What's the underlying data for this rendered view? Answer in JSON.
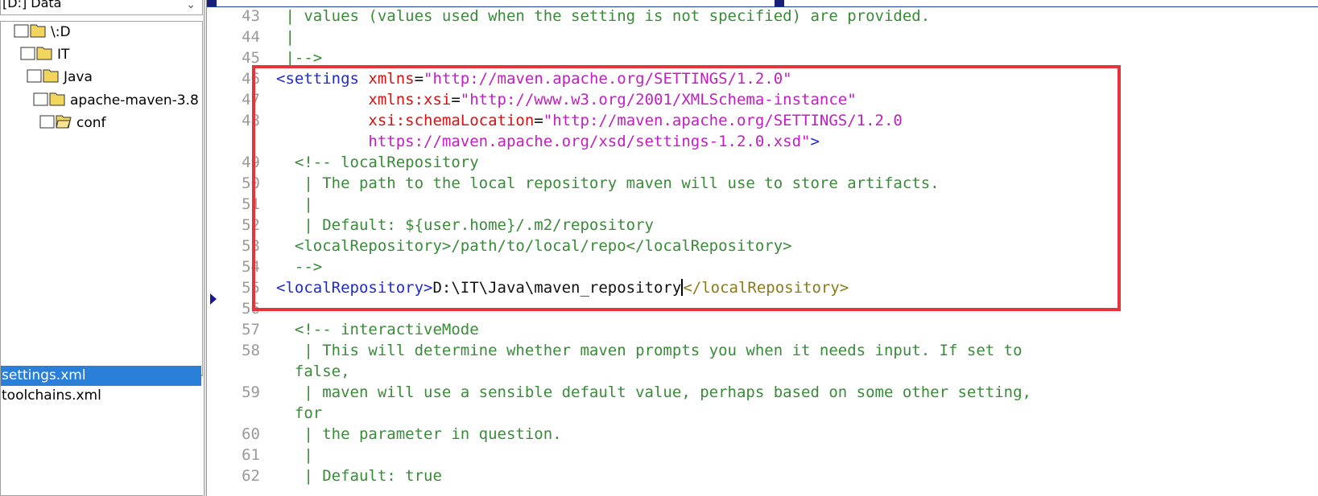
{
  "drive_selector": {
    "value": "[D:] Data"
  },
  "folder_tree": [
    {
      "label": "\\:D"
    },
    {
      "label": "IT"
    },
    {
      "label": "Java"
    },
    {
      "label": "apache-maven-3.8"
    },
    {
      "label": "conf"
    }
  ],
  "file_list": [
    {
      "label": "settings.xml",
      "selected": true
    },
    {
      "label": "toolchains.xml",
      "selected": false
    }
  ],
  "editor": {
    "lines": {
      "l43": {
        "num": "43",
        "text": " | values (values used when the setting is not specified) are provided."
      },
      "l44": {
        "num": "44",
        "text": " |"
      },
      "l45": {
        "num": "45",
        "text": " |-->"
      },
      "l46": {
        "num": "46",
        "open": "<settings ",
        "attr1": "xmlns",
        "eq1": "=",
        "val1": "\"http://maven.apache.org/SETTINGS/1.2.0\""
      },
      "l47": {
        "num": "47",
        "indent": "          ",
        "attr": "xmlns:xsi",
        "eq": "=",
        "val": "\"http://www.w3.org/2001/XMLSchema-instance\""
      },
      "l48": {
        "num": "48",
        "indent": "          ",
        "attr": "xsi:schemaLocation",
        "eq": "=",
        "val": "\"http://maven.apache.org/SETTINGS/1.2.0"
      },
      "l48b": {
        "indent": "          ",
        "val": "https://maven.apache.org/xsd/settings-1.2.0.xsd\"",
        "close": ">"
      },
      "l49": {
        "num": "49",
        "text": "  <!-- localRepository"
      },
      "l50": {
        "num": "50",
        "text": "   | The path to the local repository maven will use to store artifacts."
      },
      "l51": {
        "num": "51",
        "text": "   |"
      },
      "l52": {
        "num": "52",
        "text": "   | Default: ${user.home}/.m2/repository"
      },
      "l53": {
        "num": "53",
        "text": "  <localRepository>/path/to/local/repo</localRepository>"
      },
      "l54": {
        "num": "54",
        "text": "  -->"
      },
      "l55": {
        "num": "55",
        "open": "<localRepository>",
        "value": "D:\\IT\\Java\\maven_repository",
        "close": "</localRepository>"
      },
      "l56": {
        "num": "56",
        "text": ""
      },
      "l57": {
        "num": "57",
        "text": "  <!-- interactiveMode"
      },
      "l58": {
        "num": "58",
        "text": "   | This will determine whether maven prompts you when it needs input. If set to"
      },
      "l58b": {
        "text": "  false,"
      },
      "l59": {
        "num": "59",
        "text": "   | maven will use a sensible default value, perhaps based on some other setting,"
      },
      "l59b": {
        "text": "  for"
      },
      "l60": {
        "num": "60",
        "text": "   | the parameter in question."
      },
      "l61": {
        "num": "61",
        "text": "   |"
      },
      "l62": {
        "num": "62",
        "text": "   | Default: true"
      }
    }
  },
  "colors": {
    "comment": "#3a8a3a",
    "tag": "#1e2bd1",
    "attribute_name": "#d01414",
    "attribute_value": "#c21ec2",
    "highlight_box": "#e8333a",
    "selection": "#2a7fd9"
  }
}
